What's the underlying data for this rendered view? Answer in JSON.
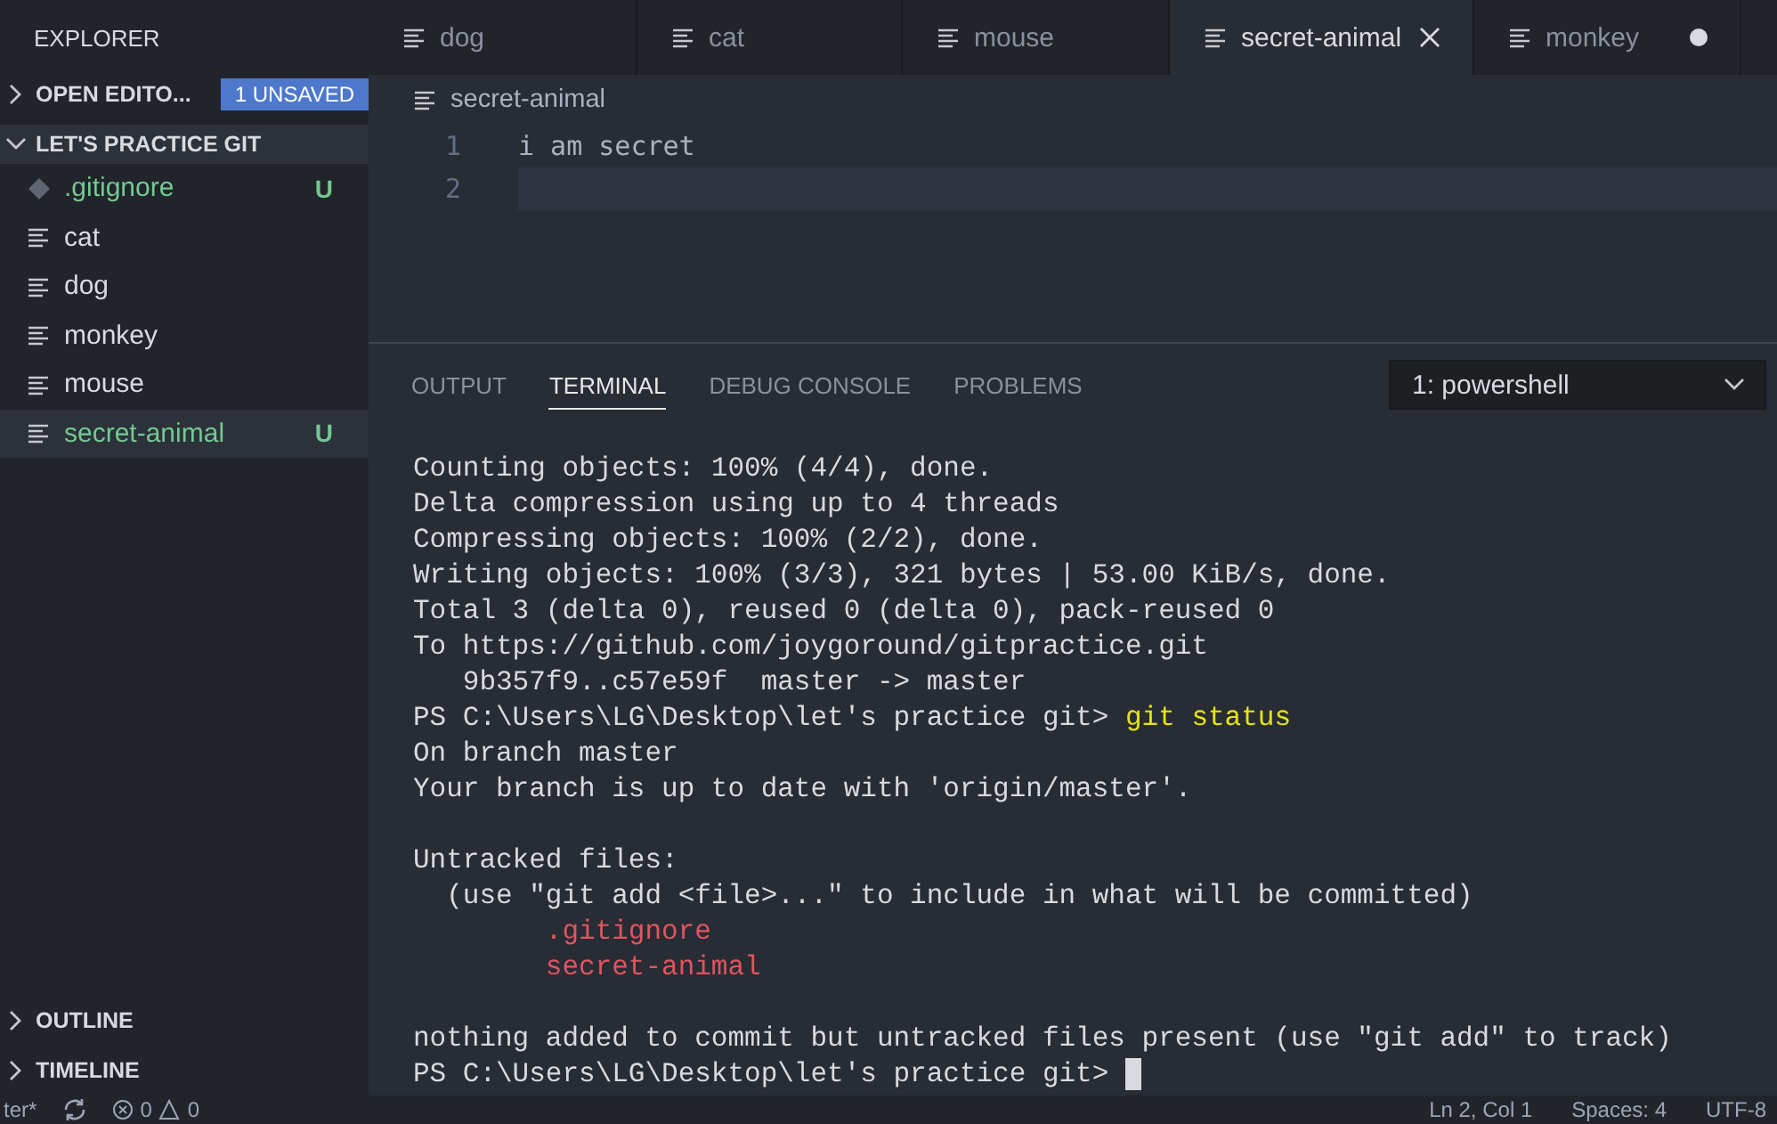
{
  "sidebar": {
    "title": "EXPLORER",
    "sections": [
      {
        "label": "OPEN EDITO...",
        "expanded": false,
        "badge": "1 UNSAVED"
      },
      {
        "label": "LET'S PRACTICE GIT",
        "expanded": true,
        "files": [
          {
            "name": ".gitignore",
            "kind": "git",
            "status": "U",
            "untracked": true,
            "selected": false
          },
          {
            "name": "cat",
            "kind": "text",
            "untracked": false,
            "selected": false
          },
          {
            "name": "dog",
            "kind": "text",
            "untracked": false,
            "selected": false
          },
          {
            "name": "monkey",
            "kind": "text",
            "untracked": false,
            "selected": false
          },
          {
            "name": "mouse",
            "kind": "text",
            "untracked": false,
            "selected": false
          },
          {
            "name": "secret-animal",
            "kind": "text",
            "status": "U",
            "untracked": true,
            "selected": true
          }
        ]
      }
    ],
    "bottom_sections": [
      {
        "label": "OUTLINE",
        "expanded": false
      },
      {
        "label": "TIMELINE",
        "expanded": false
      }
    ]
  },
  "tabs": [
    {
      "label": "dog",
      "selected": false,
      "dirty": false
    },
    {
      "label": "cat",
      "selected": false,
      "dirty": false
    },
    {
      "label": "mouse",
      "selected": false,
      "dirty": false
    },
    {
      "label": "secret-animal",
      "selected": true,
      "dirty": false
    },
    {
      "label": "monkey",
      "selected": false,
      "dirty": true
    }
  ],
  "editor": {
    "breadcrumb": "secret-animal",
    "lines": [
      {
        "number": "1",
        "text": "i am secret",
        "current": false
      },
      {
        "number": "2",
        "current": true
      }
    ]
  },
  "panel": {
    "tabs": [
      {
        "label": "OUTPUT",
        "selected": false
      },
      {
        "label": "TERMINAL",
        "selected": true
      },
      {
        "label": "DEBUG CONSOLE",
        "selected": false
      },
      {
        "label": "PROBLEMS",
        "selected": false
      }
    ],
    "terminal_select": "1: powershell",
    "lines": [
      {
        "kind": "output",
        "text": "Counting objects: 100% (4/4), done."
      },
      {
        "kind": "output",
        "text": "Delta compression using up to 4 threads"
      },
      {
        "kind": "output",
        "text": "Compressing objects: 100% (2/2), done."
      },
      {
        "kind": "output",
        "text": "Writing objects: 100% (3/3), 321 bytes | 53.00 KiB/s, done."
      },
      {
        "kind": "output",
        "text": "Total 3 (delta 0), reused 0 (delta 0), pack-reused 0"
      },
      {
        "kind": "output",
        "text": "To https://github.com/joygoround/gitpractice.git"
      },
      {
        "kind": "output",
        "text": "   9b357f9..c57e59f  master -> master"
      },
      {
        "kind": "prompt",
        "text": "PS C:\\Users\\LG\\Desktop\\let's practice git>",
        "command": "git status",
        "cursor": false
      },
      {
        "kind": "output",
        "text": "On branch master"
      },
      {
        "kind": "output",
        "text": "Your branch is up to date with 'origin/master'."
      },
      {
        "kind": "blank"
      },
      {
        "kind": "output",
        "text": "Untracked files:"
      },
      {
        "kind": "output",
        "text": "  (use \"git add <file>...\" to include in what will be committed)"
      },
      {
        "kind": "untracked",
        "text": "        .gitignore"
      },
      {
        "kind": "untracked",
        "text": "        secret-animal"
      },
      {
        "kind": "blank"
      },
      {
        "kind": "output",
        "text": "nothing added to commit but untracked files present (use \"git add\" to track)"
      },
      {
        "kind": "prompt",
        "text": "PS C:\\Users\\LG\\Desktop\\let's practice git>",
        "cursor": true
      }
    ]
  },
  "status_bar": {
    "branch": "ter*",
    "errors": "0",
    "warnings": "0",
    "right": [
      "Ln 2, Col 1",
      "Spaces: 4",
      "UTF-8"
    ]
  }
}
